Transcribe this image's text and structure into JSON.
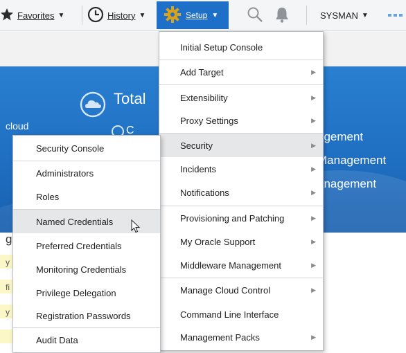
{
  "toolbar": {
    "favorites_label": "Favorites",
    "history_label": "History",
    "setup_label": "Setup",
    "user_label": "SYSMAN",
    "accent_color": "#1d6fc7"
  },
  "banner": {
    "total_label": "Total",
    "cloud_label": "cloud",
    "letter_c": "C",
    "line1": "agement",
    "line2": "Management",
    "line3": "anagement"
  },
  "lower": {
    "letter_g": "g",
    "frag1": "y",
    "frag2": "fi",
    "frag3": "y"
  },
  "setup_menu": {
    "items": [
      {
        "label": "Initial Setup Console",
        "has_submenu": false
      },
      {
        "label": "Add Target",
        "has_submenu": true
      },
      {
        "label": "Extensibility",
        "has_submenu": true
      },
      {
        "label": "Proxy Settings",
        "has_submenu": true
      },
      {
        "label": "Security",
        "has_submenu": true,
        "highlighted": true
      },
      {
        "label": "Incidents",
        "has_submenu": true
      },
      {
        "label": "Notifications",
        "has_submenu": true
      },
      {
        "label": "Provisioning and Patching",
        "has_submenu": true
      },
      {
        "label": "My Oracle Support",
        "has_submenu": true
      },
      {
        "label": "Middleware Management",
        "has_submenu": true
      },
      {
        "label": "Manage Cloud Control",
        "has_submenu": true
      },
      {
        "label": "Command Line Interface",
        "has_submenu": false
      },
      {
        "label": "Management Packs",
        "has_submenu": true
      }
    ]
  },
  "security_menu": {
    "items": [
      {
        "label": "Security Console"
      },
      {
        "label": "Administrators"
      },
      {
        "label": "Roles"
      },
      {
        "label": "Named Credentials",
        "highlighted": true
      },
      {
        "label": "Preferred Credentials"
      },
      {
        "label": "Monitoring Credentials"
      },
      {
        "label": "Privilege Delegation"
      },
      {
        "label": "Registration Passwords"
      },
      {
        "label": "Audit Data"
      }
    ]
  }
}
